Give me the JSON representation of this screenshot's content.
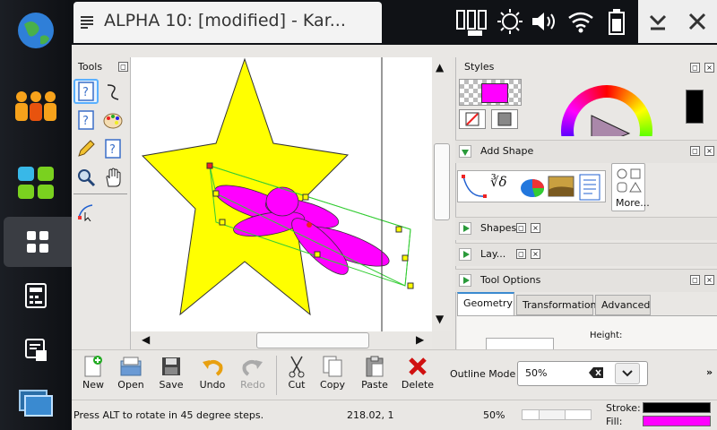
{
  "window": {
    "title": "ALPHA 10:  [modified] - Kar..."
  },
  "dock": {
    "items": [
      {
        "name": "browser-icon"
      },
      {
        "name": "contacts-icon"
      },
      {
        "name": "apps-icon"
      },
      {
        "name": "desktop-icon"
      },
      {
        "name": "calculator-icon"
      },
      {
        "name": "tasks-icon"
      },
      {
        "name": "switcher-icon"
      }
    ]
  },
  "tools_panel": {
    "title": "Tools"
  },
  "styles_panel": {
    "title": "Styles",
    "fill_color": "#ff00ff",
    "stroke_color": "#000000"
  },
  "add_shape": {
    "title": "Add Shape",
    "more_label": "More..."
  },
  "shapes_docker": {
    "title": "Shapes"
  },
  "layers_docker": {
    "title": "Lay..."
  },
  "tool_options": {
    "title": "Tool Options",
    "tabs": [
      "Geometry",
      "Transformation",
      "Advanced"
    ],
    "active_tab": "Geometry",
    "height_label": "Height:"
  },
  "toolbar": {
    "new": "New",
    "open": "Open",
    "save": "Save",
    "undo": "Undo",
    "redo": "Redo",
    "cut": "Cut",
    "copy": "Copy",
    "paste": "Paste",
    "delete": "Delete",
    "outline_label": "Outline Mode",
    "zoom_value": "50%",
    "overflow": "»"
  },
  "status": {
    "hint": "Press ALT to rotate in 45 degree steps.",
    "coords": "218.02, 1",
    "zoom": "50%",
    "stroke_label": "Stroke:",
    "fill_label": "Fill:",
    "stroke_color": "#000000",
    "fill_color": "#ff00ff"
  },
  "colors": {
    "star": "#ffff00",
    "flower": "#ff00ff",
    "selection": "#33cc33"
  }
}
